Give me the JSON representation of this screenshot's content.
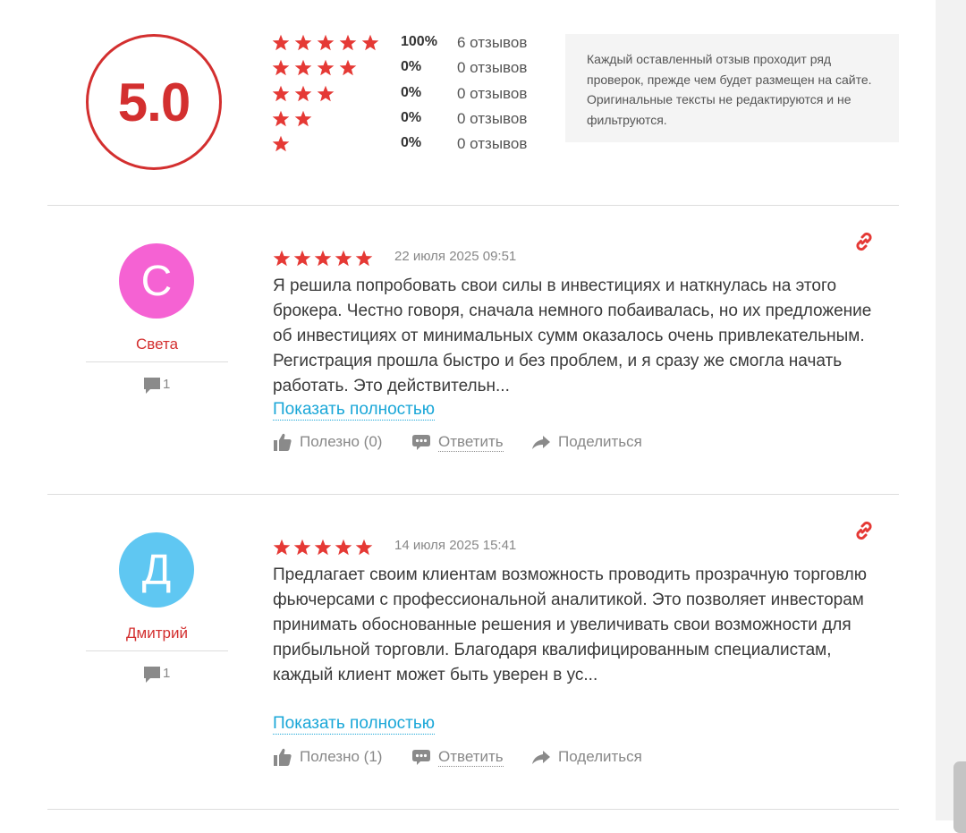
{
  "summary": {
    "average": "5.0",
    "distribution": [
      {
        "stars": 5,
        "percent": "100%",
        "count": "6 отзывов"
      },
      {
        "stars": 4,
        "percent": "0%",
        "count": "0 отзывов"
      },
      {
        "stars": 3,
        "percent": "0%",
        "count": "0 отзывов"
      },
      {
        "stars": 2,
        "percent": "0%",
        "count": "0 отзывов"
      },
      {
        "stars": 1,
        "percent": "0%",
        "count": "0 отзывов"
      }
    ],
    "notice": "Каждый оставленный отзыв проходит ряд проверок, прежде чем будет размещен на сайте. Оригинальные тексты не редактируются и не фильтруются."
  },
  "reviews": [
    {
      "avatar_letter": "С",
      "avatar_color": "#f562d3",
      "author": "Света",
      "comments": "1",
      "rating": 5,
      "date": "22 июля 2025 09:51",
      "text": "Я решила попробовать свои силы в инвестициях и наткнулась на этого брокера. Честно говоря, сначала немного побаивалась, но их предложение об инвестициях от минимальных сумм оказалось очень привлекательным. Регистрация прошла быстро и без проблем, и я сразу же смогла начать работать. Это действительн...",
      "show_more": "Показать полностью",
      "helpful": "Полезно (0)",
      "reply": "Ответить",
      "share": "Поделиться"
    },
    {
      "avatar_letter": "Д",
      "avatar_color": "#5fc7f2",
      "author": "Дмитрий",
      "comments": "1",
      "rating": 5,
      "date": "14 июля 2025 15:41",
      "text": "Предлагает своим клиентам возможность проводить прозрачную торговлю фьючерсами с профессиональной аналитикой. Это позволяет инвесторам принимать обоснованные решения и увеличивать свои возможности для прибыльной торговли. Благодаря квалифицированным специалистам, каждый клиент может быть уверен в ус...",
      "show_more": "Показать полностью",
      "helpful": "Полезно (1)",
      "reply": "Ответить",
      "share": "Поделиться"
    }
  ],
  "colors": {
    "accent": "#d32f2f",
    "star": "#e53935",
    "link": "#1aa7d8"
  },
  "icons": {
    "comment": "speech-bubble-icon",
    "helpful": "thumbs-up-icon",
    "reply": "chat-dots-icon",
    "share": "share-arrow-icon",
    "permalink": "chain-link-icon"
  }
}
